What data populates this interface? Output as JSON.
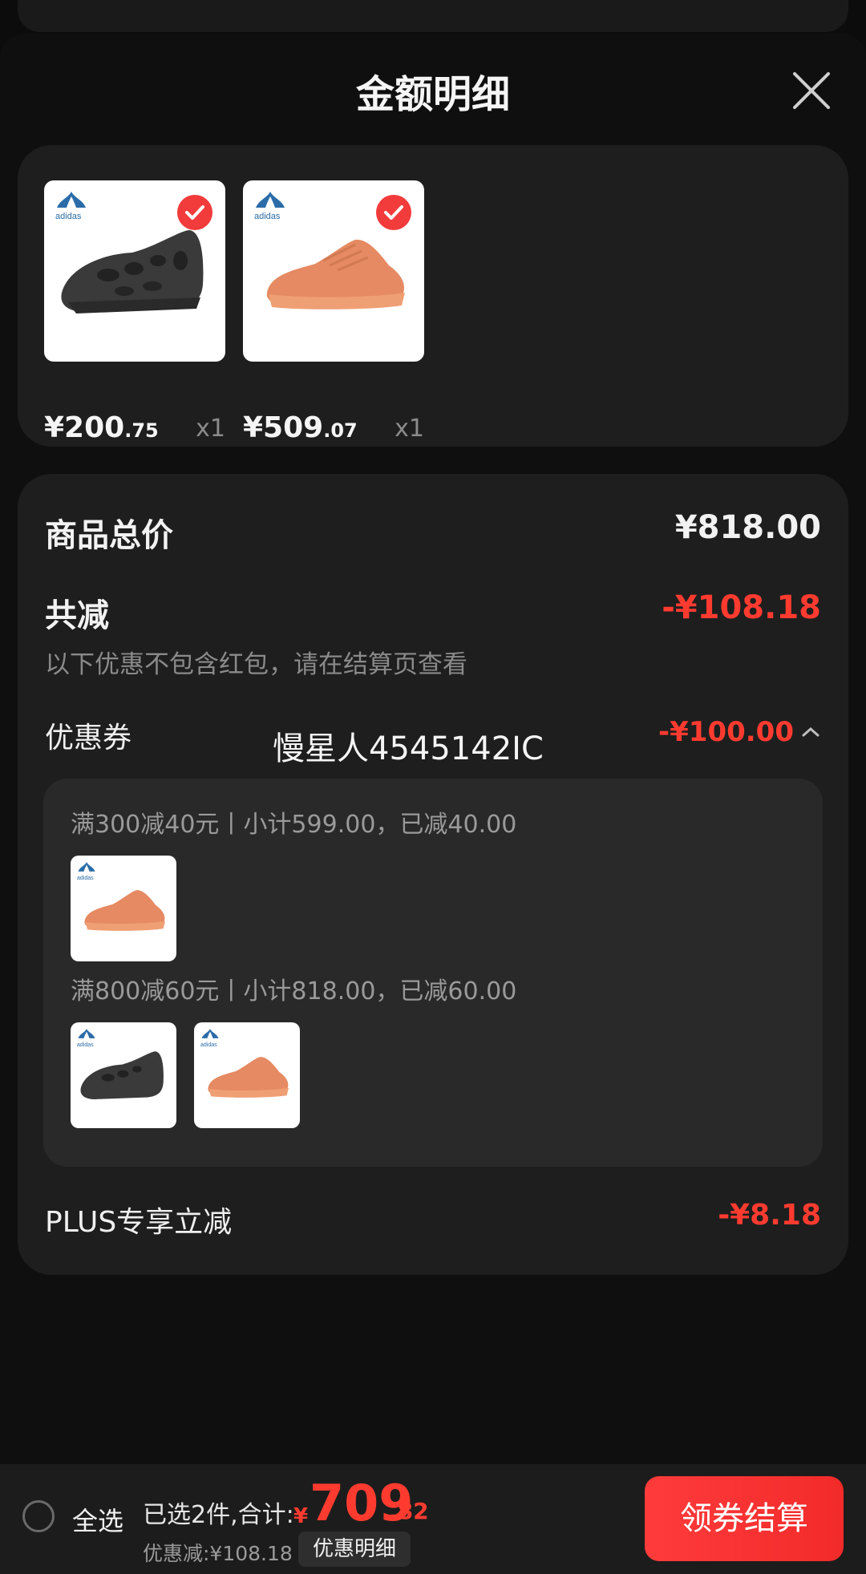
{
  "title": "金额明细",
  "products": [
    {
      "brand": "adidas",
      "price_int": "¥200",
      "price_cents": ".75",
      "qty": "x1",
      "color": "#3a3a3a"
    },
    {
      "brand": "adidas",
      "price_int": "¥509",
      "price_cents": ".07",
      "qty": "x1",
      "color": "#e58a62"
    }
  ],
  "summary": {
    "total_label": "商品总价",
    "total_value": "¥818.00",
    "reduce_label": "共减",
    "reduce_value": "-¥108.18",
    "reduce_note": "以下优惠不包含红包，请在结算页查看",
    "coupon_label": "优惠券",
    "coupon_name": "慢星人4545142IC",
    "coupon_value": "-¥100.00",
    "tier1_text": "满300减40元丨小计599.00，已减40.00",
    "tier2_text": "满800减60元丨小计818.00，已减60.00",
    "plus_label": "PLUS专享立减",
    "plus_value": "-¥8.18"
  },
  "bottom": {
    "select_all": "全选",
    "selected_label": "已选2件,合计:",
    "currency": "¥",
    "total_int": "709",
    "total_cents": ".82",
    "discount_label": "优惠减:¥108.18",
    "detail_button": "优惠明细",
    "checkout_button": "领券结算"
  },
  "colors": {
    "accent": "#ff3b30",
    "background": "#0f0f0f",
    "card": "#1e1e1e"
  }
}
